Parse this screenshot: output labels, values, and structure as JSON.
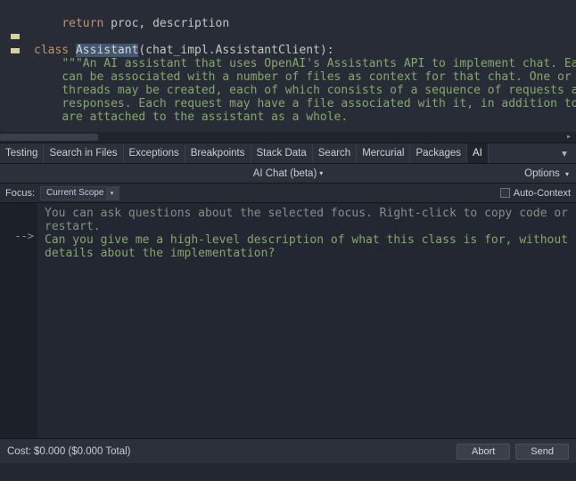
{
  "editor": {
    "return_line": "return proc, description",
    "class_kw": "class",
    "class_name": "Assistant",
    "class_rest": "(chat_impl.AssistantClient):",
    "doc1": "\"\"\"An AI assistant that uses OpenAI's Assistants API to implement chat. Each ass",
    "doc2": "can be associated with a number of files as context for that chat. One or more c",
    "doc3": "threads may be created, each of which consists of a sequence of requests and",
    "doc4": "responses. Each request may have a file associated with it, in addition to those",
    "doc5": "are attached to the assistant as a whole."
  },
  "tabs": {
    "items": [
      {
        "label": "Testing"
      },
      {
        "label": "Search in Files"
      },
      {
        "label": "Exceptions"
      },
      {
        "label": "Breakpoints"
      },
      {
        "label": "Stack Data"
      },
      {
        "label": "Search"
      },
      {
        "label": "Mercurial"
      },
      {
        "label": "Packages"
      },
      {
        "label": "AI"
      }
    ],
    "active_index": 8
  },
  "panel": {
    "title": "AI Chat (beta)",
    "options_label": "Options"
  },
  "focus": {
    "label": "Focus:",
    "value": "Current Scope",
    "auto_context_label": "Auto-Context",
    "auto_context_checked": false
  },
  "chat": {
    "gutter_marker": "-->",
    "hint1": "You can ask questions about the selected focus.  Right-click to copy code or",
    "hint2": "restart.",
    "prompt1": "Can you give me a high-level description of what this class is for, without",
    "prompt2": "details about the implementation?"
  },
  "footer": {
    "cost": "Cost: $0.000 ($0.000 Total)",
    "abort": "Abort",
    "send": "Send"
  }
}
